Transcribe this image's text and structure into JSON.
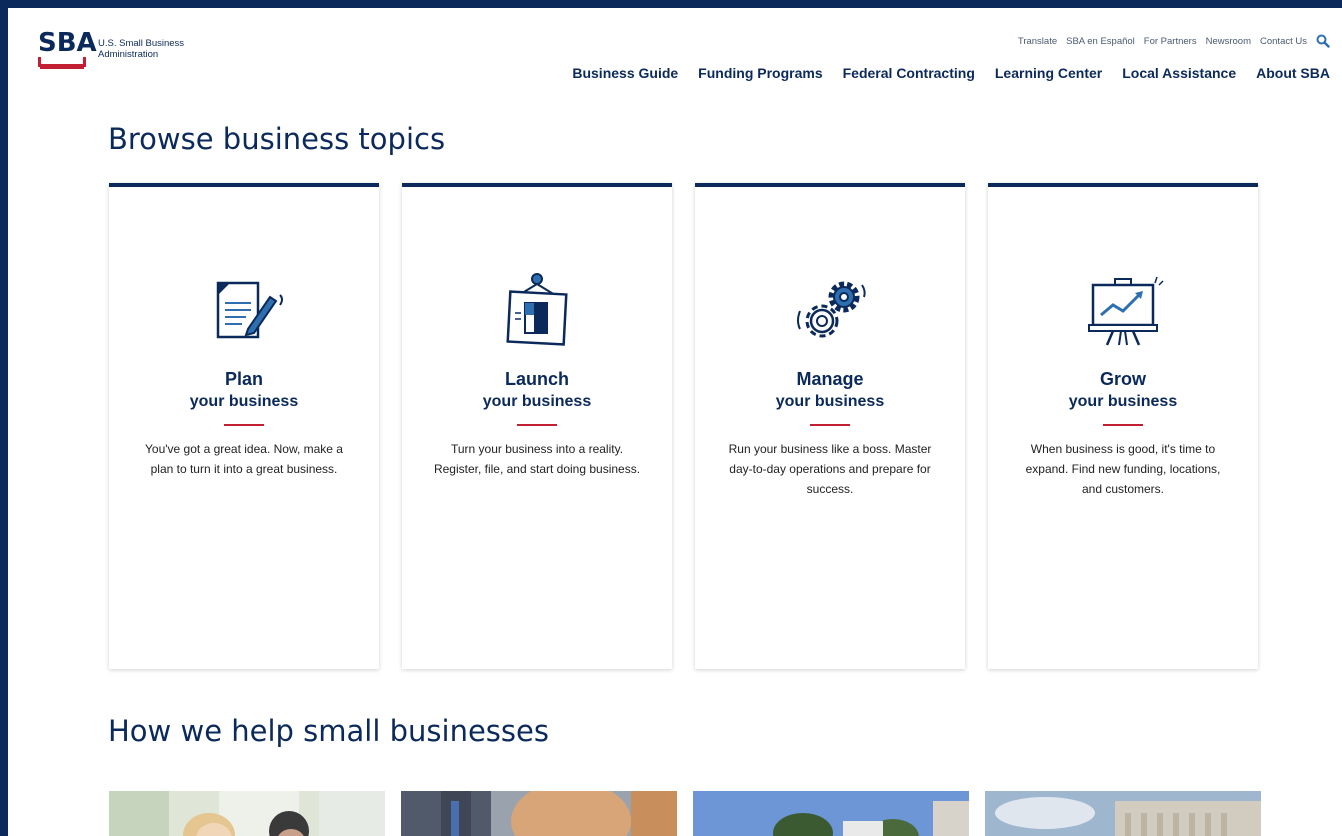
{
  "logo": {
    "mark": "SBA",
    "line1": "U.S. Small Business",
    "line2": "Administration"
  },
  "util_nav": [
    "Translate",
    "SBA en Español",
    "For Partners",
    "Newsroom",
    "Contact Us"
  ],
  "main_nav": [
    "Business Guide",
    "Funding Programs",
    "Federal Contracting",
    "Learning Center",
    "Local Assistance",
    "About SBA"
  ],
  "browse": {
    "title": "Browse business topics",
    "cards": [
      {
        "title": "Plan",
        "subtitle": "your business",
        "desc": "You've got a great idea. Now, make a plan to turn it into a great business.",
        "icon": "document-pencil-icon"
      },
      {
        "title": "Launch",
        "subtitle": "your business",
        "desc": "Turn your business into a reality. Register, file, and start doing business.",
        "icon": "hanging-sign-icon"
      },
      {
        "title": "Manage",
        "subtitle": "your business",
        "desc": "Run your business like a boss. Master day-to-day operations and prepare for success.",
        "icon": "gears-icon"
      },
      {
        "title": "Grow",
        "subtitle": "your business",
        "desc": "When business is good, it's time to expand. Find new funding, locations, and customers.",
        "icon": "growth-chart-icon"
      }
    ]
  },
  "help": {
    "title": "How we help small businesses"
  },
  "colors": {
    "navy": "#0b2a5b",
    "red": "#c21f32",
    "accent_blue": "#2e6fb0"
  }
}
